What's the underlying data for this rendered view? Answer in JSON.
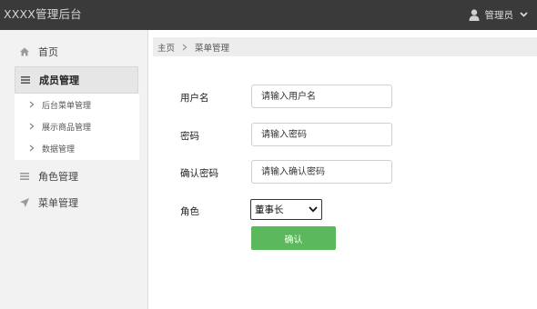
{
  "header": {
    "app_title": "XXXX管理后台",
    "user_label": "管理员",
    "icons": {
      "user": "user-icon",
      "caret": "caret-down-icon"
    }
  },
  "sidebar": {
    "items": [
      {
        "label": "首页",
        "icon": "home-icon"
      },
      {
        "label": "成员管理",
        "icon": "list-icon",
        "active": true
      },
      {
        "label": "角色管理",
        "icon": "list-icon"
      },
      {
        "label": "菜单管理",
        "icon": "send-icon"
      }
    ],
    "submenu": [
      {
        "label": "后台菜单管理"
      },
      {
        "label": "展示商品管理"
      },
      {
        "label": "数据管理"
      }
    ]
  },
  "breadcrumb": {
    "home": "主页",
    "current": "菜单管理"
  },
  "form": {
    "username": {
      "label": "用户名",
      "placeholder": "请输入用户名"
    },
    "password": {
      "label": "密码",
      "placeholder": "请输入密码"
    },
    "confirm_password": {
      "label": "确认密码",
      "placeholder": "请输入确认密码"
    },
    "role": {
      "label": "角色",
      "selected": "董事长"
    },
    "submit_label": "确认"
  },
  "colors": {
    "topbar": "#3a3a3a",
    "sidebar": "#f2f2f2",
    "primary_button": "#5cb85c"
  }
}
